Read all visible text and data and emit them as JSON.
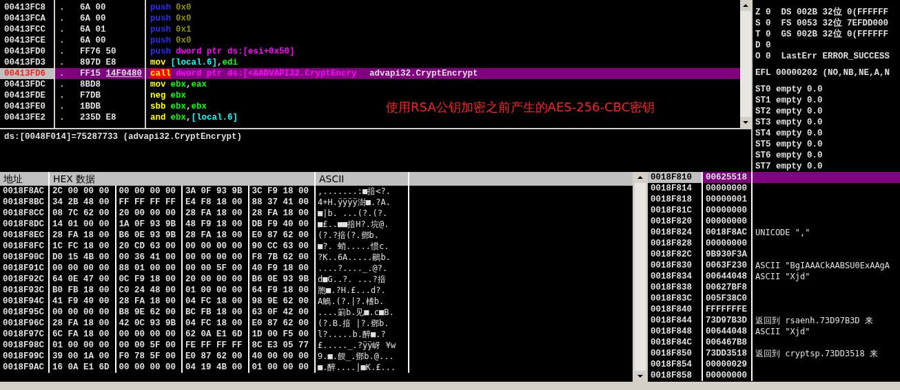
{
  "disassembly": {
    "rows": [
      {
        "address": "00413FC8",
        "marker": ".",
        "bytes": "6A 00",
        "fixup": "",
        "tokens": [
          {
            "text": "push",
            "kind": "push"
          },
          {
            "text": "0x0",
            "kind": "imm"
          }
        ],
        "comment": "",
        "selected": false
      },
      {
        "address": "00413FCA",
        "marker": ".",
        "bytes": "6A 00",
        "fixup": "",
        "tokens": [
          {
            "text": "push",
            "kind": "push"
          },
          {
            "text": "0x0",
            "kind": "imm"
          }
        ],
        "comment": "",
        "selected": false
      },
      {
        "address": "00413FCC",
        "marker": ".",
        "bytes": "6A 01",
        "fixup": "",
        "tokens": [
          {
            "text": "push",
            "kind": "push"
          },
          {
            "text": "0x1",
            "kind": "imm"
          }
        ],
        "comment": "",
        "selected": false
      },
      {
        "address": "00413FCE",
        "marker": ".",
        "bytes": "6A 00",
        "fixup": "",
        "tokens": [
          {
            "text": "push",
            "kind": "push"
          },
          {
            "text": "0x0",
            "kind": "imm"
          }
        ],
        "comment": "",
        "selected": false
      },
      {
        "address": "00413FD0",
        "marker": ".",
        "bytes": "FF76 50",
        "fixup": "",
        "tokens": [
          {
            "text": "push",
            "kind": "push"
          },
          {
            "text": "dword ptr ds:[esi+0x50]",
            "kind": "mem"
          }
        ],
        "comment": "",
        "selected": false
      },
      {
        "address": "00413FD3",
        "marker": ".",
        "bytes": "897D E8",
        "fixup": "",
        "tokens": [
          {
            "text": "mov",
            "kind": "op"
          },
          {
            "text": "[local.6]",
            "kind": "local"
          },
          {
            "text": ",",
            "kind": "sep"
          },
          {
            "text": "edi",
            "kind": "reg"
          }
        ],
        "comment": "",
        "selected": false
      },
      {
        "address": "00413FD6",
        "marker": ".",
        "bytes": "FF15",
        "fixup": "14F0480",
        "tokens": [
          {
            "text": "call",
            "kind": "call"
          },
          {
            "text": "dword ptr ds:[<&ADVAPI32.CryptEncry",
            "kind": "mem"
          }
        ],
        "comment": "advapi32.CryptEncrypt",
        "selected": true
      },
      {
        "address": "00413FDC",
        "marker": ".",
        "bytes": "8BD8",
        "fixup": "",
        "tokens": [
          {
            "text": "mov",
            "kind": "op"
          },
          {
            "text": "ebx",
            "kind": "reg"
          },
          {
            "text": ",",
            "kind": "sep"
          },
          {
            "text": "eax",
            "kind": "reg"
          }
        ],
        "comment": "",
        "selected": false
      },
      {
        "address": "00413FDE",
        "marker": ".",
        "bytes": "F7DB",
        "fixup": "",
        "tokens": [
          {
            "text": "neg",
            "kind": "op"
          },
          {
            "text": "ebx",
            "kind": "reg"
          }
        ],
        "comment": "",
        "selected": false
      },
      {
        "address": "00413FE0",
        "marker": ".",
        "bytes": "1BDB",
        "fixup": "",
        "tokens": [
          {
            "text": "sbb",
            "kind": "op"
          },
          {
            "text": "ebx",
            "kind": "reg"
          },
          {
            "text": ",",
            "kind": "sep"
          },
          {
            "text": "ebx",
            "kind": "reg"
          }
        ],
        "comment": "",
        "selected": false
      },
      {
        "address": "00413FE2",
        "marker": ".",
        "bytes": "235D E8",
        "fixup": "",
        "tokens": [
          {
            "text": "and",
            "kind": "op"
          },
          {
            "text": "ebx",
            "kind": "reg"
          },
          {
            "text": ",",
            "kind": "sep"
          },
          {
            "text": "[local.6]",
            "kind": "local"
          }
        ],
        "comment": "",
        "selected": false
      }
    ]
  },
  "annotation": "使用RSA公钥加密之前产生的AES-256-CBC密钥",
  "info_line": "ds:[0048F014]=75287733 (advapi32.CryptEncrypt)",
  "registers": {
    "flags": [
      "Z 0  DS 002B 32位 0(FFFFFF",
      "S 0  FS 0053 32位 7EFDD000",
      "T 0  GS 002B 32位 0(FFFFFF",
      "D 0",
      "O 0  LastErr ERROR_SUCCESS"
    ],
    "efl": "EFL 00000202 (NO,NB,NE,A,N",
    "fpu": [
      "ST0 empty 0.0",
      "ST1 empty 0.0",
      "ST2 empty 0.0",
      "ST3 empty 0.0",
      "ST4 empty 0.0",
      "ST5 empty 0.0",
      "ST6 empty 0.0",
      "ST7 empty 0.0"
    ]
  },
  "dump": {
    "columns": [
      "地址",
      "HEX 数据",
      "ASCII"
    ],
    "rows": [
      {
        "address": "0018F8AC",
        "groups": [
          "2C 00 00 00",
          "00 00 00 00",
          "3A 0F 93 9B",
          "3C F9 18 00"
        ],
        "ascii": ",.......:■揞<?."
      },
      {
        "address": "0018F8BC",
        "groups": [
          "34 2B 48 00",
          "FF FF FF FF",
          "E4 F8 18 00",
          "88 37 41 00"
        ],
        "ascii": "4+H.ÿÿÿÿ澍■.?A."
      },
      {
        "address": "0018F8CC",
        "groups": [
          "08 7C 62 00",
          "20 00 00 00",
          "28 FA 18 00",
          "28 FA 18 00"
        ],
        "ascii": "■|b. ...(?.(?."
      },
      {
        "address": "0018F8DC",
        "groups": [
          "14 01 00 00",
          "1A 0F 93 9B",
          "48 F9 18 00",
          "DB F9 40 00"
        ],
        "ascii": "■£..■■揞H?.垸@."
      },
      {
        "address": "0018F8EC",
        "groups": [
          "28 FA 18 00",
          "B6 0E 93 9B",
          "28 FA 18 00",
          "E0 87 62 00"
        ],
        "ascii": "(?.?揞(?.鄧b."
      },
      {
        "address": "0018F8FC",
        "groups": [
          "1C FC 18 00",
          "20 CD 63 00",
          "00 00 00 00",
          "90 CC 63 00"
        ],
        "ascii": "■?. 蛸.....惯c."
      },
      {
        "address": "0018F90C",
        "groups": [
          "D0 15 4B 00",
          "00 36 41 00",
          "00 00 00 00",
          "F8 7B 62 00"
        ],
        "ascii": "?K..6A.....鶍b."
      },
      {
        "address": "0018F91C",
        "groups": [
          "00 00 00 00",
          "88 01 00 00",
          "00 00 5F 00",
          "40 F9 18 00"
        ],
        "ascii": "....?...._.@?."
      },
      {
        "address": "0018F92C",
        "groups": [
          "64 0E 47 00",
          "0C F9 18 00",
          "20 00 00 00",
          "B6 0E 93 9B"
        ],
        "ascii": "d■G..?. ...?揞"
      },
      {
        "address": "0018F93C",
        "groups": [
          "B0 FB 18 00",
          "C0 24 48 00",
          "01 00 00 00",
          "64 F9 18 00"
        ],
        "ascii": "胞■.?H.£...d?."
      },
      {
        "address": "0018F94C",
        "groups": [
          "41 F9 40 00",
          "28 FA 18 00",
          "04 FC 18 00",
          "98 9E 62 00"
        ],
        "ascii": "A鵤.(?.|?.榰b."
      },
      {
        "address": "0018F95C",
        "groups": [
          "00 00 00 00",
          "B8 9E 62 00",
          "BC FB 18 00",
          "63 0F 42 00"
        ],
        "ascii": "....箣b.见■.c■B."
      },
      {
        "address": "0018F96C",
        "groups": [
          "28 FA 18 00",
          "42 0C 93 9B",
          "04 FC 18 00",
          "E0 87 62 00"
        ],
        "ascii": "(?.B.揞 |?.鄧b."
      },
      {
        "address": "0018F97C",
        "groups": [
          "6C FA 18 00",
          "00 00 00 00",
          "62 0A E1 6D",
          "1D 00 F5 00"
        ],
        "ascii": "l?.....b.醉■.?"
      },
      {
        "address": "0018F98C",
        "groups": [
          "01 00 00 00",
          "00 00 5F 00",
          "FE FF FF FF",
          "8C E3 05 77"
        ],
        "ascii": "£....._.?ÿÿ岈 ¥w"
      },
      {
        "address": "0018F99C",
        "groups": [
          "39 00 1A 00",
          "F0 78 5F 00",
          "E0 87 62 00",
          "40 00 00 00"
        ],
        "ascii": "9.■.饃_.鄧b.@..."
      },
      {
        "address": "0018F9AC",
        "groups": [
          "16 0A E1 6D",
          "00 00 00 00",
          "04 19 4B 00",
          "01 00 00 00"
        ],
        "ascii": "■.醉....|■K.£..."
      }
    ]
  },
  "stack": {
    "rows": [
      {
        "address": "0018F810",
        "value": "00625518",
        "comment": "",
        "selected": true
      },
      {
        "address": "0018F814",
        "value": "00000000",
        "comment": "",
        "selected": false
      },
      {
        "address": "0018F818",
        "value": "00000001",
        "comment": "",
        "selected": false
      },
      {
        "address": "0018F81C",
        "value": "00000000",
        "comment": "",
        "selected": false
      },
      {
        "address": "0018F820",
        "value": "00000000",
        "comment": "",
        "selected": false
      },
      {
        "address": "0018F824",
        "value": "0018F8AC",
        "comment": "UNICODE \",\"",
        "selected": false
      },
      {
        "address": "0018F828",
        "value": "00000000",
        "comment": "",
        "selected": false
      },
      {
        "address": "0018F82C",
        "value": "9B930F3A",
        "comment": "",
        "selected": false
      },
      {
        "address": "0018F830",
        "value": "0063F230",
        "comment": "ASCII \"BgIAAACkAABSU0ExAAgA",
        "selected": false
      },
      {
        "address": "0018F834",
        "value": "00644048",
        "comment": "ASCII \"Xjd\"",
        "selected": false
      },
      {
        "address": "0018F838",
        "value": "00627BF8",
        "comment": "",
        "selected": false
      },
      {
        "address": "0018F83C",
        "value": "005F38C0",
        "comment": "",
        "selected": false
      },
      {
        "address": "0018F840",
        "value": "FFFFFFFE",
        "comment": "",
        "selected": false
      },
      {
        "address": "0018F844",
        "value": "73D97B3D",
        "comment": "返回到 rsaenh.73D97B3D 来",
        "selected": false
      },
      {
        "address": "0018F848",
        "value": "00644048",
        "comment": "ASCII \"Xjd\"",
        "selected": false
      },
      {
        "address": "0018F84C",
        "value": "006467B8",
        "comment": "",
        "selected": false
      },
      {
        "address": "0018F850",
        "value": "73DD3518",
        "comment": "返回到 cryptsp.73DD3518 来",
        "selected": false
      },
      {
        "address": "0018F854",
        "value": "00000029",
        "comment": "",
        "selected": false
      },
      {
        "address": "0018F858",
        "value": "00000000",
        "comment": "",
        "selected": false
      }
    ]
  }
}
